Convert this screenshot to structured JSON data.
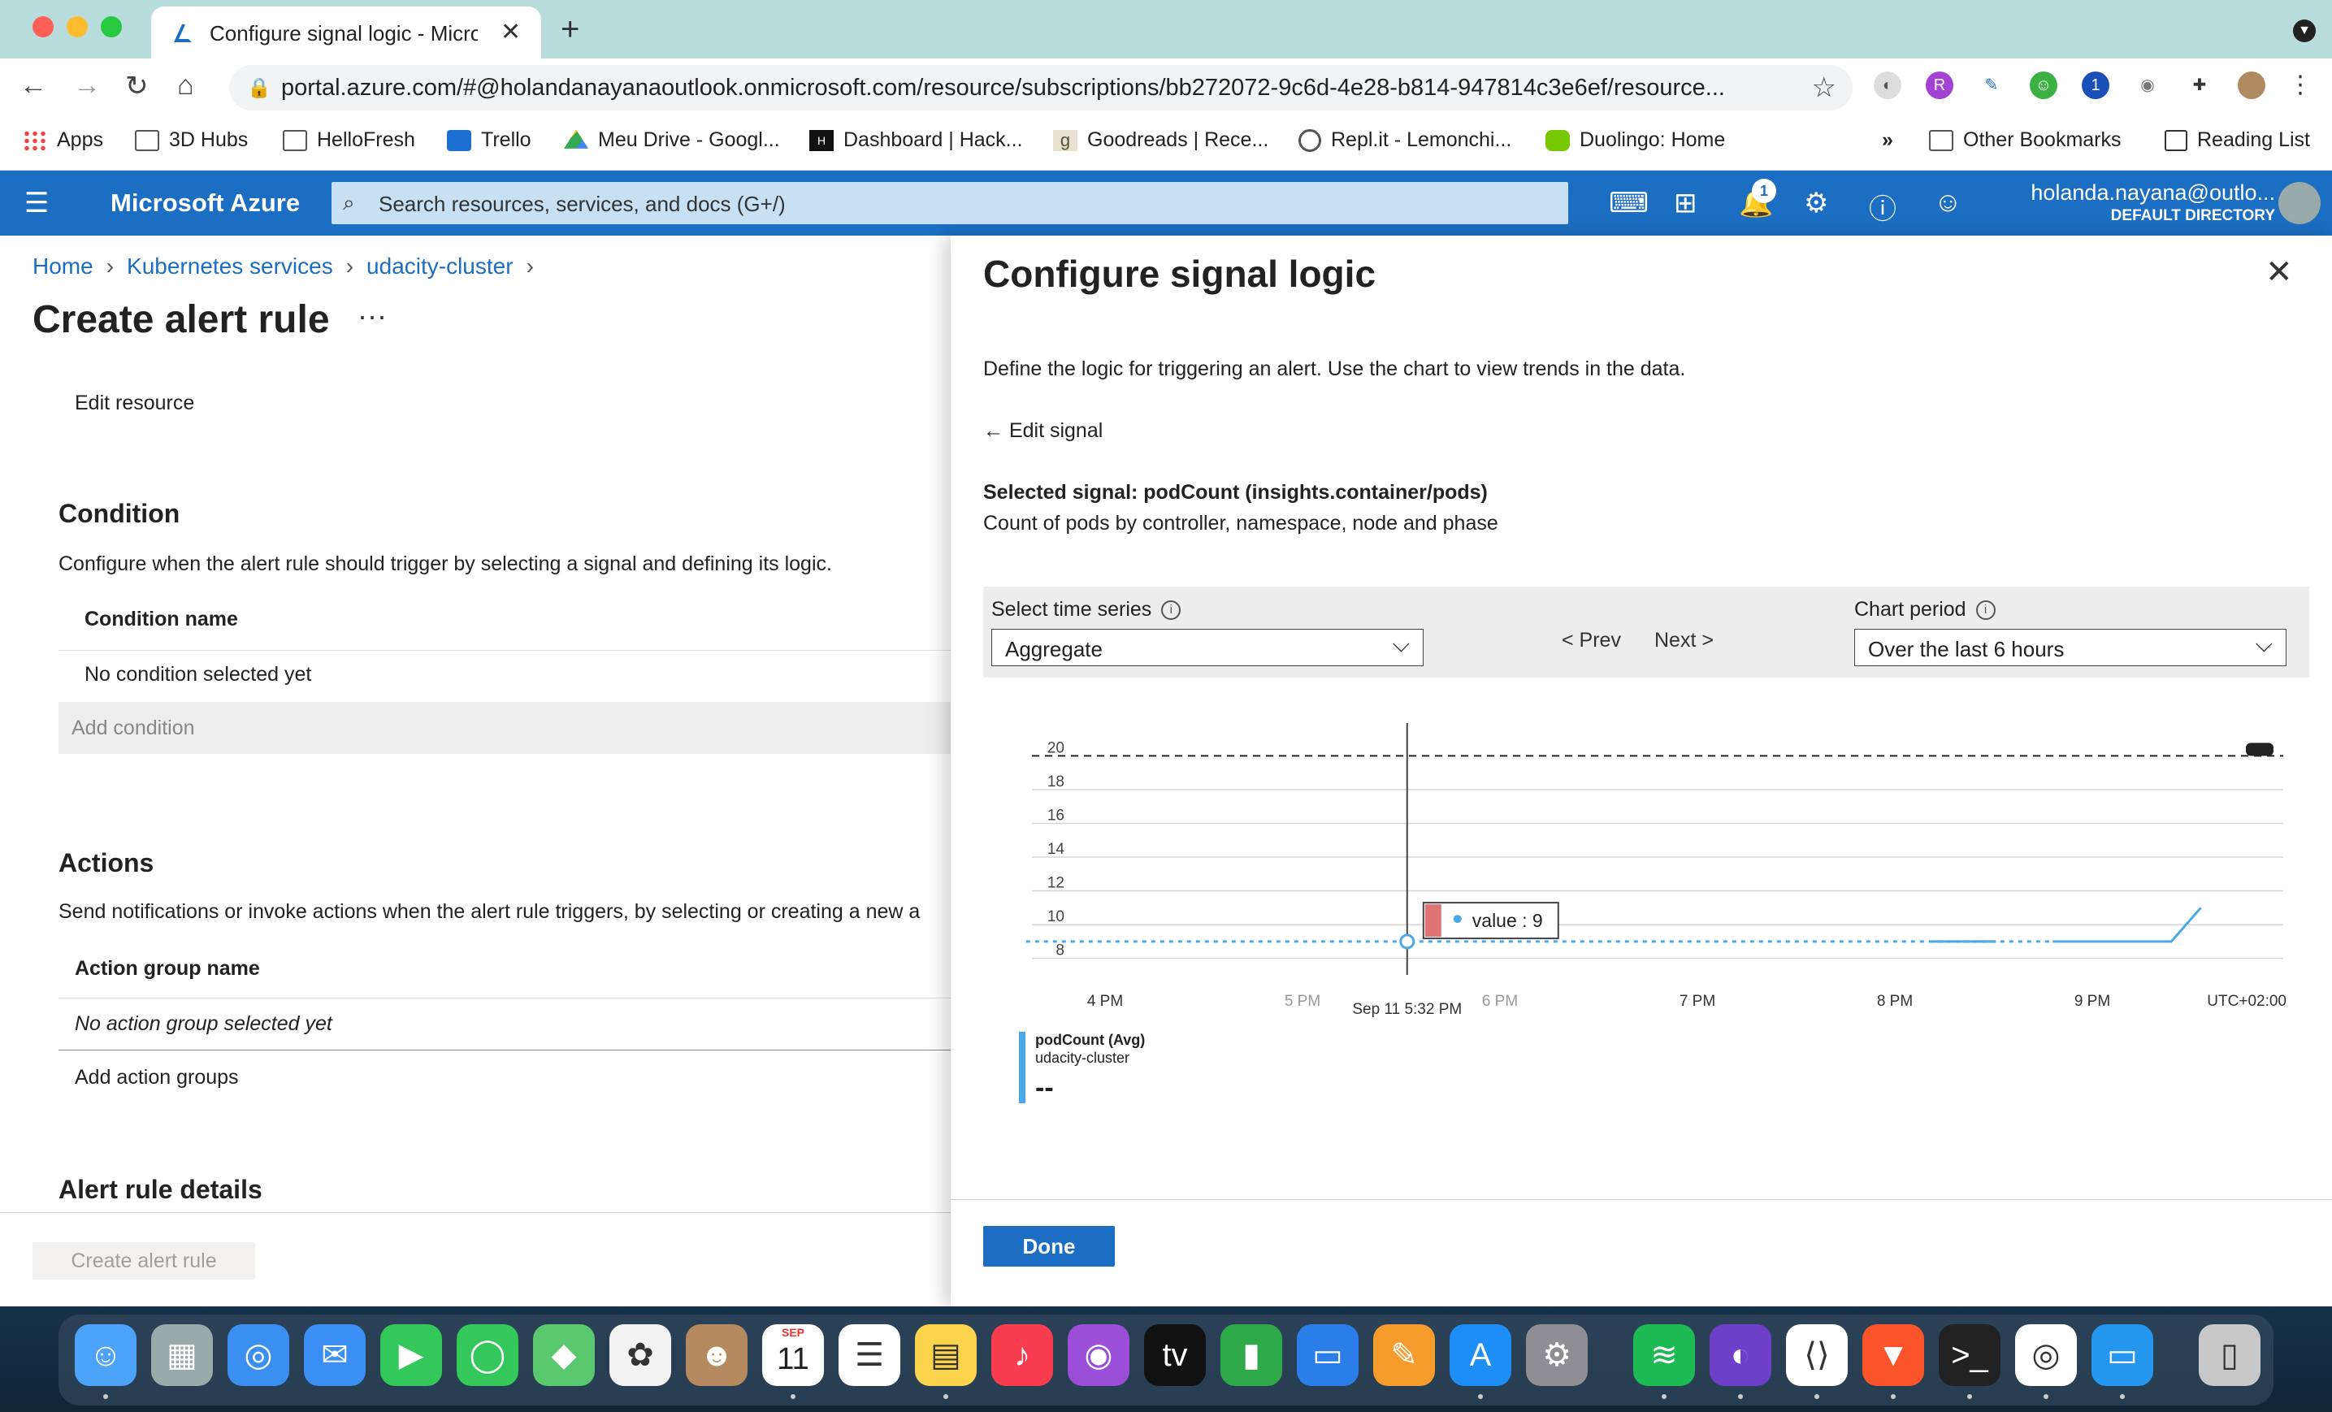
{
  "browser": {
    "tab_title": "Configure signal logic - Microsoft Azure",
    "url": "portal.azure.com/#@holandanayanaoutlook.onmicrosoft.com/resource/subscriptions/bb272072-9c6d-4e28-b814-947814c3e6ef/resource...",
    "bookmarks": [
      "Apps",
      "3D Hubs",
      "HelloFresh",
      "Trello",
      "Meu Drive - Googl...",
      "Dashboard | Hack...",
      "Goodreads | Rece...",
      "Repl.it - Lemonchi...",
      "Duolingo: Home"
    ],
    "more_bookmarks": "»",
    "other_bookmarks": "Other Bookmarks",
    "reading_list": "Reading List"
  },
  "azure": {
    "brand": "Microsoft Azure",
    "search_placeholder": "Search resources, services, and docs (G+/)",
    "notification_count": "1",
    "user_name": "holanda.nayana@outlo...",
    "directory": "DEFAULT DIRECTORY"
  },
  "left": {
    "breadcrumb": [
      "Home",
      "Kubernetes services",
      "udacity-cluster"
    ],
    "title": "Create alert rule",
    "more": "···",
    "edit_resource": "Edit resource",
    "condition_heading": "Condition",
    "condition_desc": "Configure when the alert rule should trigger by selecting a signal and defining its logic.",
    "condition_name_header": "Condition name",
    "no_condition": "No condition selected yet",
    "add_condition": "Add condition",
    "actions_heading": "Actions",
    "actions_desc": "Send notifications or invoke actions when the alert rule triggers, by selecting or creating a new a",
    "action_group_header": "Action group name",
    "no_action_group": "No action group selected yet",
    "add_action_groups": "Add action groups",
    "details_heading": "Alert rule details",
    "create_button": "Create alert rule"
  },
  "panel": {
    "title": "Configure signal logic",
    "close": "✕",
    "description": "Define the logic for triggering an alert. Use the chart to view trends in the data.",
    "edit_signal": "Edit signal",
    "selected_signal": "Selected signal: podCount (insights.container/pods)",
    "signal_desc": "Count of pods by controller, namespace, node and phase",
    "time_series_label": "Select time series",
    "time_series_value": "Aggregate",
    "prev": "< Prev",
    "next": "Next >",
    "chart_period_label": "Chart period",
    "chart_period_value": "Over the last 6 hours",
    "done": "Done"
  },
  "chart_data": {
    "type": "line",
    "y_ticks": [
      8,
      10,
      12,
      14,
      16,
      18,
      20
    ],
    "ylim": [
      7.5,
      20.5
    ],
    "x_ticks": [
      "4 PM",
      "5 PM",
      "6 PM",
      "7 PM",
      "8 PM",
      "9 PM"
    ],
    "timezone": "UTC+02:00",
    "threshold": 20,
    "cursor_label": "Sep 11 5:32 PM",
    "tooltip": "value : 9",
    "series": [
      {
        "name": "podCount (Avg)",
        "subtitle": "udacity-cluster",
        "legend_value": "--",
        "color": "#4aa9e6",
        "x_hours": [
          15.6,
          20.8,
          21.4,
          21.55
        ],
        "values": [
          9,
          9,
          9,
          11
        ]
      }
    ]
  },
  "dock": {
    "calendar_month": "SEP",
    "calendar_day": "11"
  }
}
